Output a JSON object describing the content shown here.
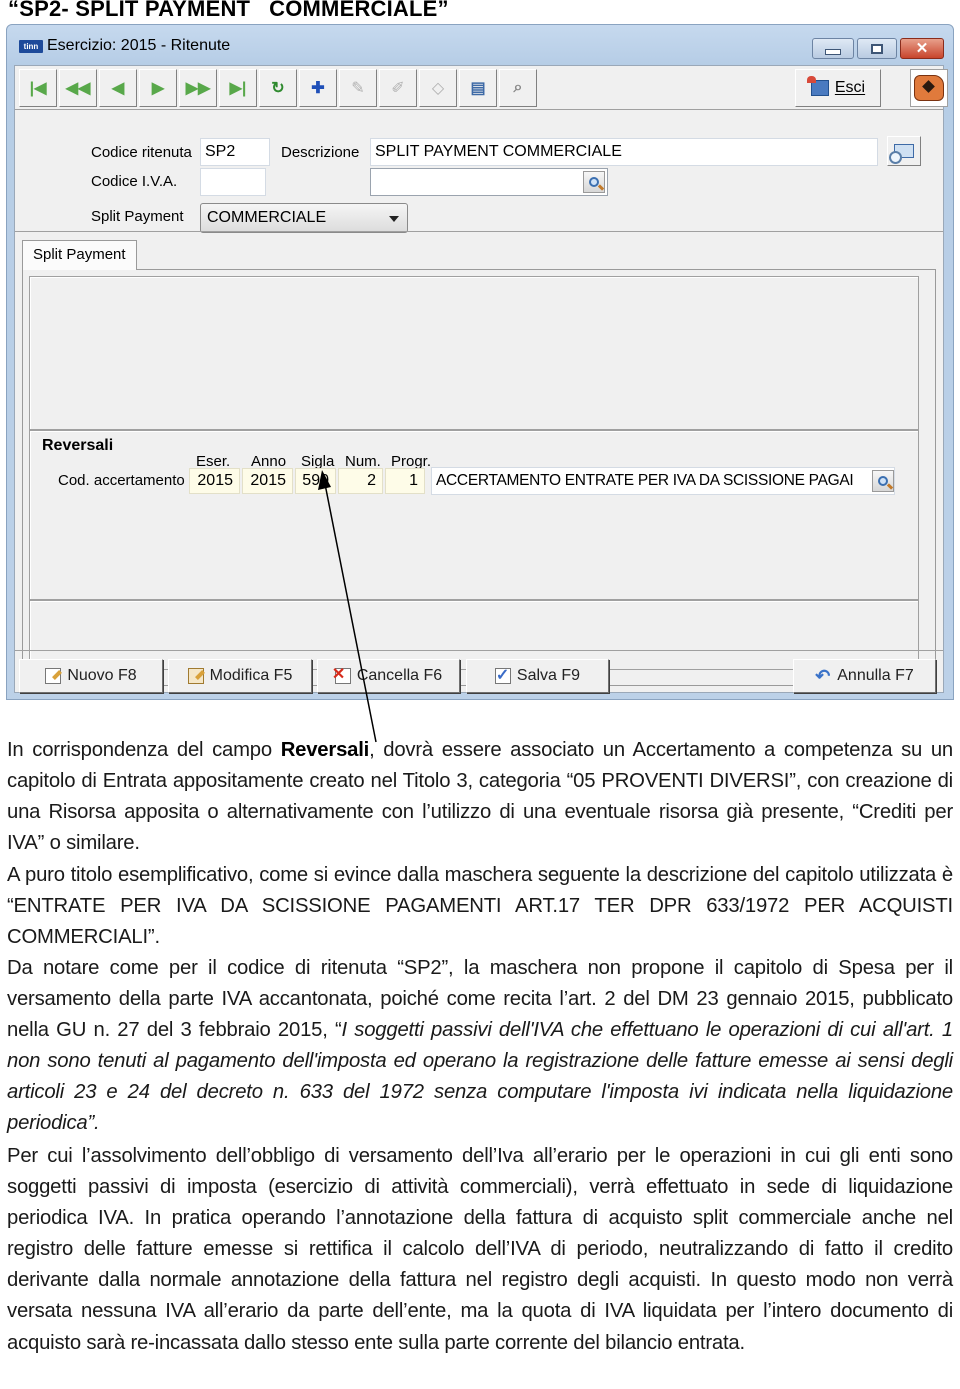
{
  "document": {
    "heading": "“SP2- SPLIT PAYMENT   COMMERCIALE”"
  },
  "window": {
    "app_logo": "tinn",
    "title": "Esercizio: 2015 - Ritenute",
    "controls": {
      "minimize": "minimize",
      "maximize": "maximize",
      "close": "close"
    }
  },
  "toolbar": {
    "buttons": [
      {
        "name": "first-record",
        "icon": "first-icon",
        "glyph": "|◀",
        "enabled": true
      },
      {
        "name": "previous-page",
        "icon": "rewind-icon",
        "glyph": "◀◀",
        "enabled": true
      },
      {
        "name": "previous-record",
        "icon": "arrow-left-icon",
        "glyph": "◀",
        "enabled": true
      },
      {
        "name": "next-record",
        "icon": "arrow-right-icon",
        "glyph": "▶",
        "enabled": true
      },
      {
        "name": "next-page",
        "icon": "fast-forward-icon",
        "glyph": "▶▶",
        "enabled": true
      },
      {
        "name": "last-record",
        "icon": "last-icon",
        "glyph": "▶|",
        "enabled": true
      },
      {
        "name": "refresh",
        "icon": "refresh-icon",
        "glyph": "↻",
        "enabled": true
      },
      {
        "name": "new-record",
        "icon": "new-record-icon",
        "glyph": "✚",
        "enabled": true
      },
      {
        "name": "edit-disabled",
        "icon": "edit-record-icon",
        "glyph": "✎",
        "enabled": false
      },
      {
        "name": "delete-disabled",
        "icon": "remove-record-icon",
        "glyph": "✐",
        "enabled": false
      },
      {
        "name": "clear-disabled",
        "icon": "eraser-icon",
        "glyph": "◇",
        "enabled": false
      },
      {
        "name": "search-list",
        "icon": "search-list-icon",
        "glyph": "▤",
        "enabled": true
      },
      {
        "name": "filter-search",
        "icon": "filter-search-icon",
        "glyph": "⌕",
        "enabled": true
      }
    ],
    "exit_label": "Esci",
    "help_icon": "help-icon"
  },
  "form": {
    "codice_ritenuta_label": "Codice ritenuta",
    "codice_ritenuta_value": "SP2",
    "descrizione_label": "Descrizione",
    "descrizione_value": "SPLIT PAYMENT COMMERCIALE",
    "codice_iva_label": "Codice I.V.A.",
    "codice_iva_value": "",
    "codice_iva_desc_value": "",
    "split_payment_label": "Split Payment",
    "split_payment_value": "COMMERCIALE"
  },
  "tabs": [
    {
      "label": "Split Payment",
      "active": true
    }
  ],
  "reversali": {
    "title": "Reversali",
    "row_label": "Cod. accertamento",
    "columns": [
      "Eser.",
      "Anno",
      "Sigla",
      "Num.",
      "Progr."
    ],
    "values": [
      "2015",
      "2015",
      "590",
      "2",
      "1"
    ],
    "description": "ACCERTAMENTO ENTRATE PER IVA DA SCISSIONE PAGAI"
  },
  "actions": {
    "nuovo": "Nuovo F8",
    "modifica": "Modifica F5",
    "cancella": "Cancella F6",
    "salva": "Salva F9",
    "annulla": "Annulla F7"
  },
  "body": {
    "p1_before": "In corrispondenza del campo ",
    "p1_bold": "Reversali",
    "p1_after": ", dovrà essere associato un Accertamento a competenza su un capitolo di Entrata appositamente creato nel Titolo 3,  categoria “05 PROVENTI DIVERSI”, con creazione di una Risorsa apposita o alternativamente con l’utilizzo di una eventuale risorsa già presente,  “Crediti per IVA” o similare.",
    "p2": "A puro titolo esemplificativo, come si evince dalla maschera seguente la descrizione del capitolo  utilizzata è “ENTRATE PER IVA DA SCISSIONE PAGAMENTI ART.17 TER DPR 633/1972 PER ACQUISTI COMMERCIALI”.",
    "p3_before": "Da notare come per il codice di ritenuta “SP2”, la maschera non propone il capitolo di Spesa per il versamento della parte IVA accantonata, poiché come recita l’art. 2 del DM 23 gennaio 2015, pubblicato nella GU n. 27 del 3 febbraio 2015,  “",
    "p3_italic": "I soggetti passivi dell'IVA che effettuano le operazioni di  cui all'art. 1 non sono tenuti al pagamento dell'imposta  ed operano  la registrazione delle fatture emesse ai sensi degli articoli  23  e  24 del decreto n. 633 del 1972 senza computare  l'imposta  ivi  indicata nella liquidazione periodica”.",
    "p4": "Per cui l’assolvimento dell’obbligo di versamento dell’Iva all’erario per le operazioni in cui gli enti sono soggetti passivi di imposta (esercizio di attività commerciali), verrà effettuato in sede di liquidazione periodica IVA. In pratica operando l’annotazione della fattura di acquisto split commerciale anche nel registro delle fatture emesse si rettifica il calcolo dell’IVA di periodo, neutralizzando di fatto il credito derivante dalla normale annotazione della fattura nel registro degli acquisti. In questo modo non verrà versata nessuna IVA all’erario da parte dell’ente, ma la quota di IVA liquidata per l’intero documento di acquisto sarà re-incassata dallo stesso ente sulla parte corrente del bilancio entrata."
  }
}
